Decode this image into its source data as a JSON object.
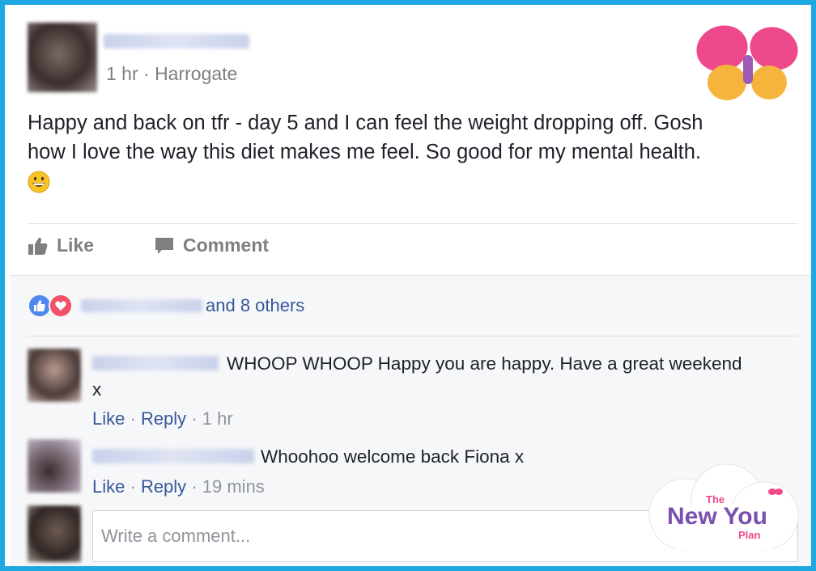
{
  "post": {
    "meta": "1 hr · Harrogate",
    "text_line1": "Happy and back on tfr - day 5 and I can feel the weight dropping off. Gosh",
    "text_line2": "how I love the way this diet makes me feel. So good for my mental health.",
    "close_glyph": "×"
  },
  "actions": {
    "like_label": "Like",
    "comment_label": "Comment"
  },
  "reactions": {
    "text": "and 8 others"
  },
  "comments": [
    {
      "text_line1": "WHOOP WHOOP Happy you are happy. Have a great weekend",
      "text_line2": "x",
      "like": "Like",
      "reply": "Reply",
      "time": "1 hr"
    },
    {
      "text_line1": "Whoohoo welcome back Fiona x",
      "like": "Like",
      "reply": "Reply",
      "time": "19 mins"
    }
  ],
  "composer": {
    "placeholder": "Write a comment..."
  },
  "brand": {
    "logo_the": "The",
    "logo_main": "New You",
    "logo_plan": "Plan",
    "frame_color": "#1ea7e0"
  }
}
